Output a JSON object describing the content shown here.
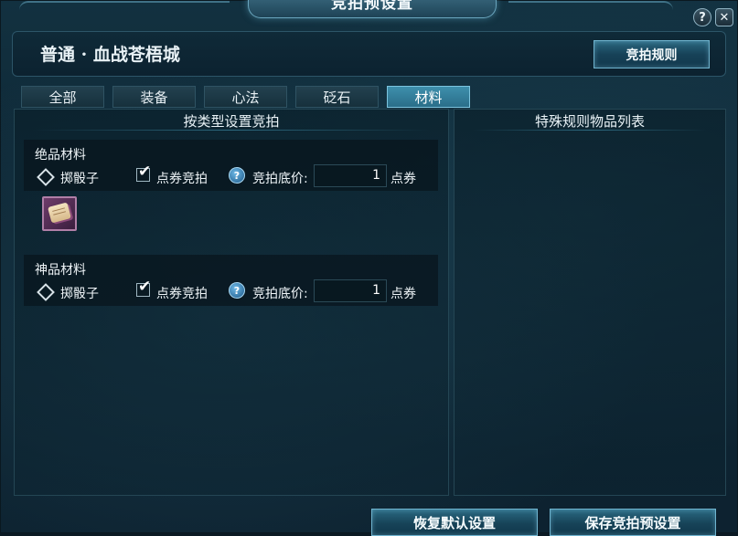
{
  "window": {
    "title": "竞拍预设置",
    "help_glyph": "?",
    "close_glyph": "✕"
  },
  "header": {
    "zone_title": "普通 · 血战苍梧城",
    "rules_button": "竞拍规则"
  },
  "tabs": [
    {
      "label": "全部",
      "active": false
    },
    {
      "label": "装备",
      "active": false
    },
    {
      "label": "心法",
      "active": false
    },
    {
      "label": "砭石",
      "active": false
    },
    {
      "label": "材料",
      "active": true
    }
  ],
  "left_panel": {
    "heading": "按类型设置竞拍",
    "groups": [
      {
        "title": "绝品材料",
        "option_dice": "掷骰子",
        "option_points": "点券竞拍",
        "points_checked": true,
        "help_glyph": "?",
        "price_label": "竞拍底价:",
        "price_value": "1",
        "price_unit": "点券",
        "item_icon": "scroll-icon"
      },
      {
        "title": "神品材料",
        "option_dice": "掷骰子",
        "option_points": "点券竞拍",
        "points_checked": true,
        "help_glyph": "?",
        "price_label": "竞拍底价:",
        "price_value": "1",
        "price_unit": "点券"
      }
    ]
  },
  "right_panel": {
    "heading": "特殊规则物品列表"
  },
  "footer": {
    "restore_button": "恢复默认设置",
    "save_button": "保存竞拍预设置"
  },
  "check_glyph": "✔",
  "colors": {
    "accent": "#3e8fac",
    "panel_bg": "#0e2634",
    "button_border": "#6fb4cf"
  }
}
